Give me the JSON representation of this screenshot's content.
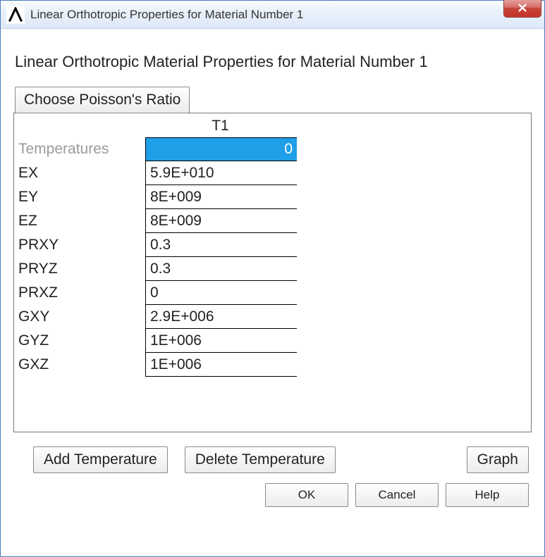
{
  "window": {
    "title": "Linear Orthotropic Properties for Material Number 1"
  },
  "heading": "Linear Orthotropic Material Properties for Material Number 1",
  "choose_button": "Choose Poisson's Ratio",
  "grid": {
    "column_header": "T1",
    "rows": [
      {
        "label": "Temperatures",
        "value": "0",
        "highlight": true,
        "muted": true
      },
      {
        "label": "EX",
        "value": "5.9E+010"
      },
      {
        "label": "EY",
        "value": "8E+009"
      },
      {
        "label": "EZ",
        "value": "8E+009"
      },
      {
        "label": "PRXY",
        "value": "0.3"
      },
      {
        "label": "PRYZ",
        "value": "0.3"
      },
      {
        "label": "PRXZ",
        "value": "0"
      },
      {
        "label": "GXY",
        "value": "2.9E+006"
      },
      {
        "label": "GYZ",
        "value": "1E+006"
      },
      {
        "label": "GXZ",
        "value": "1E+006"
      }
    ]
  },
  "buttons": {
    "add_temp": "Add Temperature",
    "delete_temp": "Delete Temperature",
    "graph": "Graph",
    "ok": "OK",
    "cancel": "Cancel",
    "help": "Help"
  }
}
